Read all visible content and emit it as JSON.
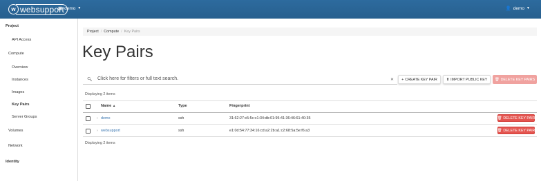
{
  "header": {
    "logo_text": "websupport",
    "logo_mark": "w",
    "project": "demo",
    "user": "demo"
  },
  "sidebar": {
    "project": "Project",
    "api_access": "API Access",
    "compute": "Compute",
    "overview": "Overview",
    "instances": "Instances",
    "images": "Images",
    "key_pairs": "Key Pairs",
    "server_groups": "Server Groups",
    "volumes": "Volumes",
    "network": "Network",
    "identity": "Identity"
  },
  "breadcrumb": {
    "items": [
      "Project",
      "Compute",
      "Key Pairs"
    ],
    "separator": "/"
  },
  "page": {
    "title": "Key Pairs"
  },
  "filter": {
    "placeholder": "Click here for filters or full text search."
  },
  "actions": {
    "create": "CREATE KEY PAIR",
    "import": "IMPORT PUBLIC KEY",
    "delete": "DELETE KEY PAIRS"
  },
  "table": {
    "count_top": "Displaying 2 items",
    "count_bottom": "Displaying 2 items",
    "columns": [
      "Name",
      "Type",
      "Fingerprint"
    ],
    "rows": [
      {
        "name": "demo",
        "type": "ssh",
        "fingerprint": "31:62:27:c5:5c:c1:34:db:01:95:41:36:46:61:40:35",
        "action": "DELETE KEY PAIR"
      },
      {
        "name": "websupport",
        "type": "ssh",
        "fingerprint": "e1:0d:54:77:34:16:cd:a2:2b:a1:c2:68:5a:5e:f6:a3",
        "action": "DELETE KEY PAIR"
      }
    ]
  },
  "colors": {
    "topbar": "#2a6496",
    "danger": "#e45550",
    "link": "#3a76b0"
  }
}
